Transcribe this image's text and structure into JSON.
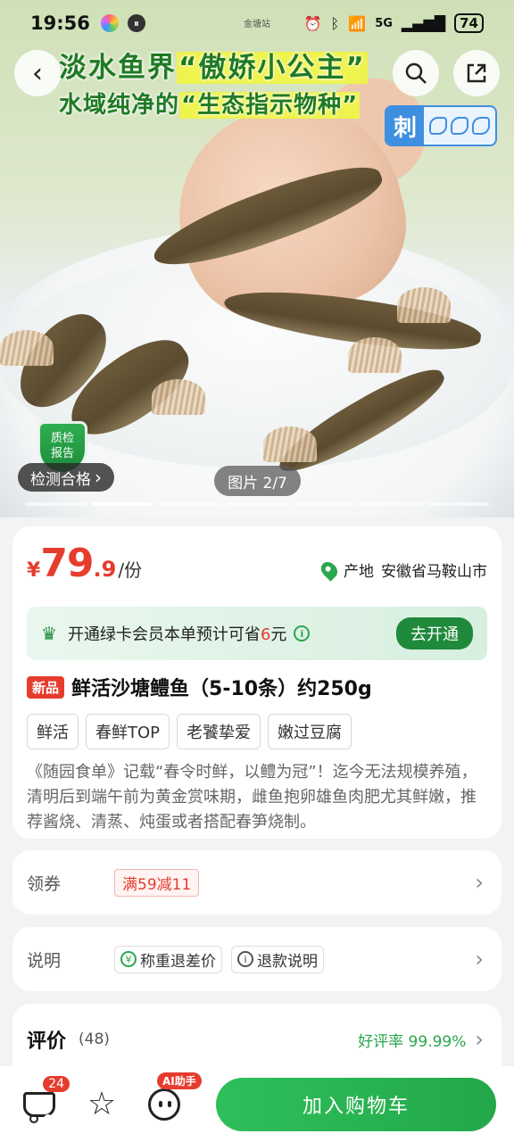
{
  "status_bar": {
    "time": "19:56",
    "center_label": "金塘站",
    "network": "5G",
    "battery": "74"
  },
  "hero": {
    "title_pre": "淡水鱼界",
    "title_hl": "“傲娇小公主”",
    "subtitle_pre": "水域纯净的",
    "subtitle_hl": "“生态指示物种”",
    "spine_badge": "刺",
    "qc_badge_line1": "质检",
    "qc_badge_line2": "报告",
    "qc_pill": "检测合格",
    "image_counter": "图片 2/7",
    "image_index": 2,
    "image_total": 7
  },
  "nav": {
    "back_icon": "back-icon",
    "search_icon": "search-icon",
    "share_icon": "share-icon"
  },
  "price": {
    "currency": "¥",
    "integer": "79",
    "decimal": ".9",
    "unit": "/份",
    "origin_label": "产地",
    "origin_value": "安徽省马鞍山市"
  },
  "member": {
    "text_pre": "开通绿卡会员本单预计可省",
    "amount": "6",
    "text_post": "元",
    "button": "去开通"
  },
  "product": {
    "new_badge": "新品",
    "title": "鲜活沙塘鳢鱼（5-10条）约250g",
    "tags": [
      "鲜活",
      "春鲜TOP",
      "老饕挚爱",
      "嫩过豆腐"
    ],
    "description": "《随园食单》记载“春令时鲜，以鳢为冠”！迄今无法规模养殖，清明后到端午前为黄金赏味期，雌鱼抱卵雄鱼肉肥尤其鲜嫩，推荐酱烧、清蒸、炖蛋或者搭配春笋烧制。"
  },
  "coupon_row": {
    "label": "领券",
    "coupon": "满59减11"
  },
  "notes_row": {
    "label": "说明",
    "items": [
      "称重退差价",
      "退款说明"
    ]
  },
  "review_row": {
    "label": "评价",
    "count": "(48)",
    "rating": "好评率 99.99%"
  },
  "bottom_bar": {
    "cart_count": "24",
    "ai_tag": "AI助手",
    "add_to_cart": "加入购物车"
  },
  "colors": {
    "accent_green": "#23a84a",
    "price_red": "#e63c2e"
  }
}
